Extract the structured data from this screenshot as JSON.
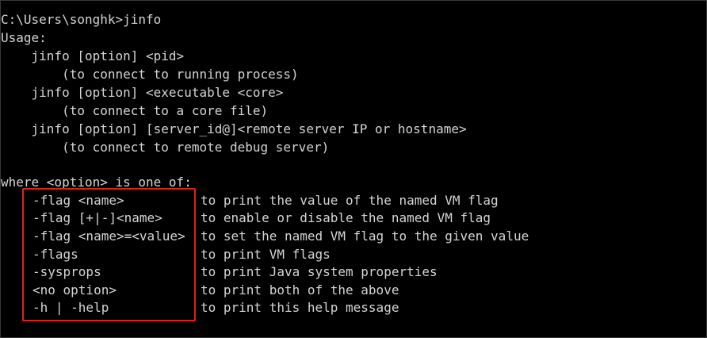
{
  "console": {
    "lines": [
      "C:\\Users\\songhk>jinfo",
      "Usage:",
      "    jinfo [option] <pid>",
      "        (to connect to running process)",
      "    jinfo [option] <executable <core>",
      "        (to connect to a core file)",
      "    jinfo [option] [server_id@]<remote server IP or hostname>",
      "        (to connect to remote debug server)",
      "",
      "where <option> is one of:"
    ],
    "options": [
      {
        "name": "-flag <name>",
        "desc": "to print the value of the named VM flag"
      },
      {
        "name": "-flag [+|-]<name>",
        "desc": "to enable or disable the named VM flag"
      },
      {
        "name": "-flag <name>=<value>",
        "desc": "to set the named VM flag to the given value"
      },
      {
        "name": "-flags",
        "desc": "to print VM flags"
      },
      {
        "name": "-sysprops",
        "desc": "to print Java system properties"
      },
      {
        "name": "<no option>",
        "desc": "to print both of the above"
      },
      {
        "name": "-h | -help",
        "desc": "to print this help message"
      }
    ]
  },
  "colors": {
    "background": "#000000",
    "text": "#d4d4d4",
    "highlight_border": "#e02020"
  }
}
